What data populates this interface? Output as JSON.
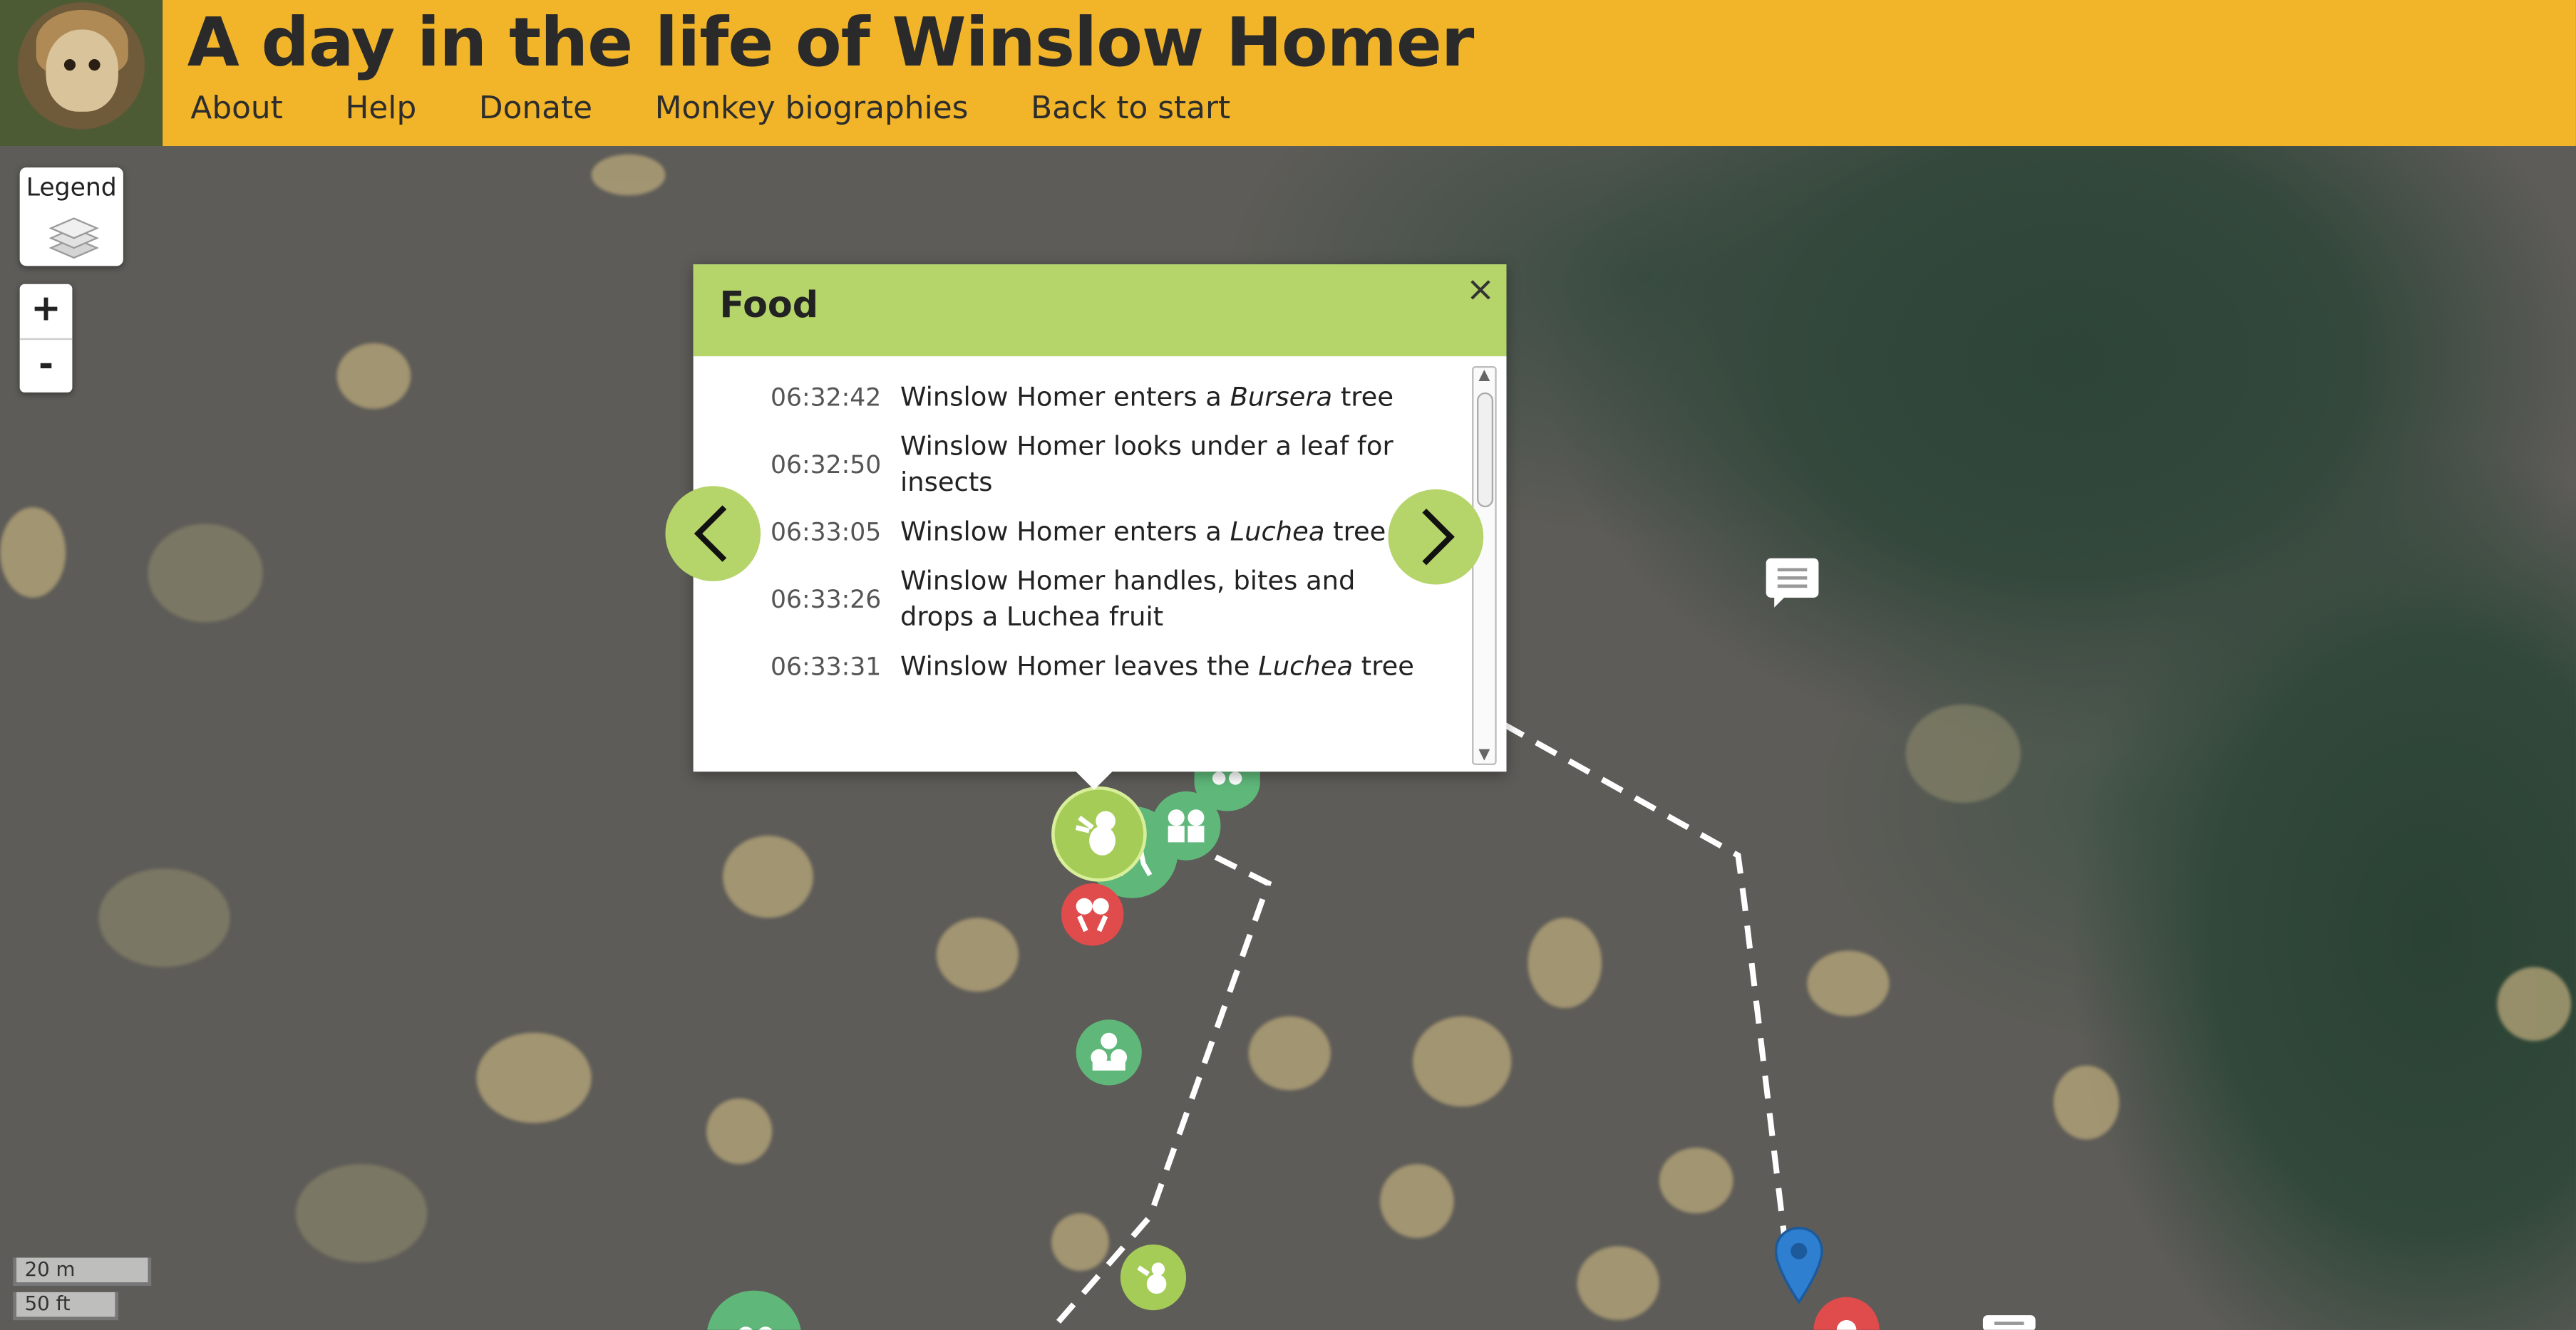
{
  "header": {
    "title": "A day in the life of Winslow Homer",
    "nav": [
      "About",
      "Help",
      "Donate",
      "Monkey biographies",
      "Back to start"
    ]
  },
  "map_controls": {
    "legend_label": "Legend",
    "zoom_in": "+",
    "zoom_out": "-",
    "scale_metric": "20 m",
    "scale_imperial": "50 ft"
  },
  "popup": {
    "title": "Food",
    "close": "×",
    "entries": [
      {
        "time": "06:32:42",
        "text_parts": [
          "Winslow Homer enters a ",
          "Bursera",
          " tree"
        ]
      },
      {
        "time": "06:32:50",
        "text": "Winslow Homer looks under a leaf for insects"
      },
      {
        "time": "06:33:05",
        "text_parts": [
          "Winslow Homer enters a ",
          "Luchea",
          " tree"
        ]
      },
      {
        "time": "06:33:26",
        "text": "Winslow Homer handles, bites and drops a Luchea fruit"
      },
      {
        "time": "06:33:31",
        "text_parts": [
          "Winslow Homer leaves the ",
          "Luchea",
          " tree"
        ]
      }
    ]
  },
  "colors": {
    "header": "#f2b52a",
    "popup_header": "#b5d46a",
    "marker_green": "#5fb87a",
    "marker_lime": "#a6cc58",
    "marker_red": "#e04b4b",
    "pin_blue": "#2f7fd0"
  },
  "icons": {
    "legend": "layers-icon",
    "prev": "chevron-left-icon",
    "next": "chevron-right-icon",
    "comment": "comment-icon",
    "pin": "map-pin-icon"
  }
}
